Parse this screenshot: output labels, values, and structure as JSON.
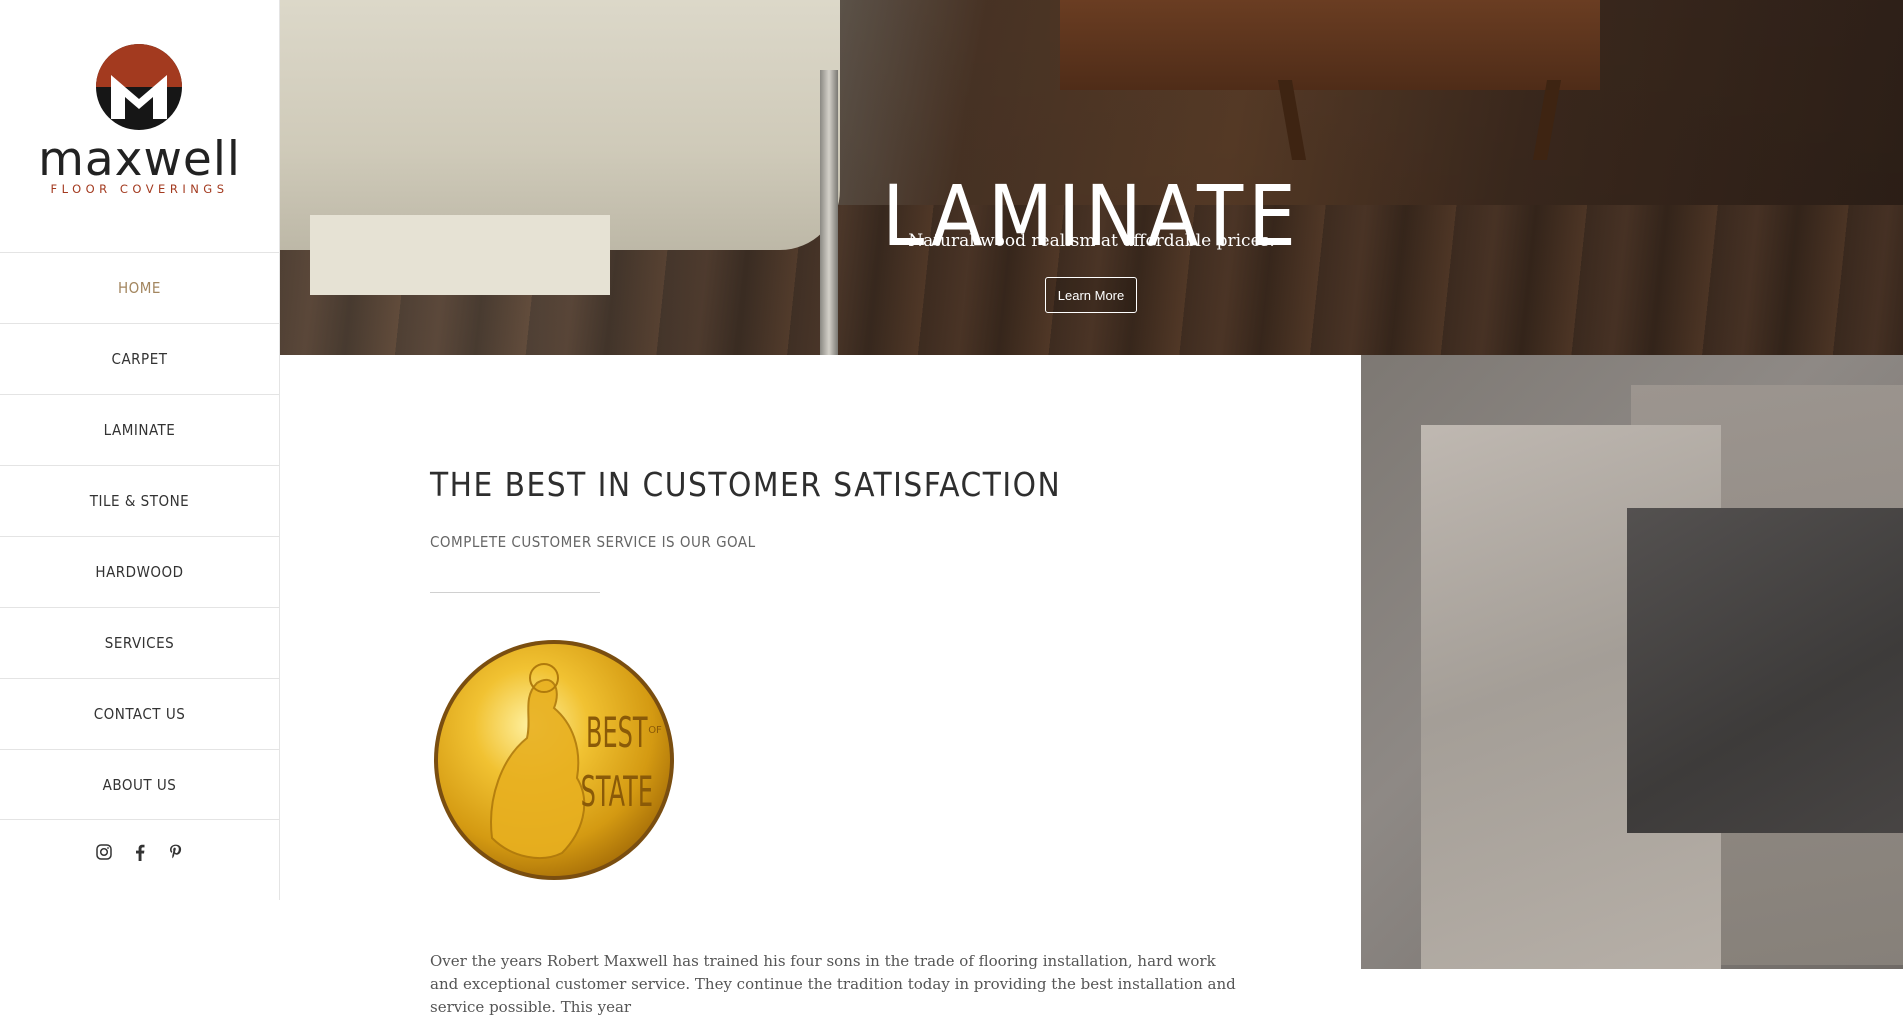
{
  "logo": {
    "word": "maxwell",
    "sub": "FLOOR COVERINGS"
  },
  "nav": [
    {
      "label": "HOME",
      "active": true
    },
    {
      "label": "CARPET"
    },
    {
      "label": "LAMINATE"
    },
    {
      "label": "TILE & STONE"
    },
    {
      "label": "HARDWOOD"
    },
    {
      "label": "SERVICES"
    },
    {
      "label": "CONTACT US"
    },
    {
      "label": "ABOUT US"
    }
  ],
  "social": [
    "instagram-icon",
    "facebook-icon",
    "pinterest-icon"
  ],
  "hero": {
    "title": "LAMINATE",
    "subtitle": "Natural wood realism at affordable prices.",
    "button": "Learn More"
  },
  "main": {
    "heading": "THE BEST IN CUSTOMER SATISFACTION",
    "subheading": "COMPLETE CUSTOMER SERVICE IS OUR GOAL",
    "medal_text_top": "BEST",
    "medal_text_of": "OF",
    "medal_text_bottom": "STATE",
    "body": "Over the years Robert Maxwell has trained his four sons in the trade of flooring installation, hard work and exceptional customer service. They continue the tradition today in providing the best installation and service possible. This year"
  },
  "colors": {
    "accent": "#a3865f",
    "brand_red": "#a33a1f"
  }
}
